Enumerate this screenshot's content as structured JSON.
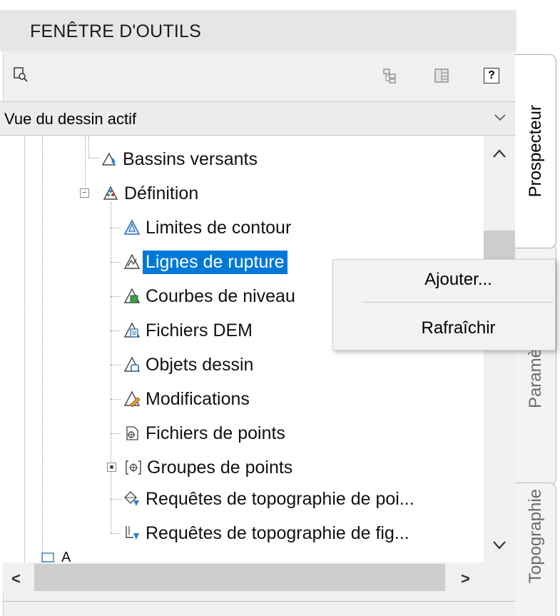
{
  "window": {
    "title": "FENÊTRE D'OUTILS"
  },
  "toolbar": {
    "icons": [
      "search-drawing-icon",
      "tree-view-icon",
      "item-view-icon",
      "help-icon"
    ],
    "help_label": "?"
  },
  "view_select": {
    "value": "Vue du dessin actif"
  },
  "tree": {
    "items": [
      {
        "label": "Bassins versants",
        "icon": "catchment-icon"
      },
      {
        "label": "Définition",
        "icon": "surface-definition-icon",
        "expander": "−"
      },
      {
        "label": "Limites de contour",
        "icon": "boundary-icon"
      },
      {
        "label": "Lignes de rupture",
        "icon": "breakline-icon",
        "selected": true
      },
      {
        "label": "Courbes de niveau",
        "icon": "contour-icon"
      },
      {
        "label": "Fichiers DEM",
        "icon": "dem-file-icon"
      },
      {
        "label": "Objets dessin",
        "icon": "drawing-object-icon"
      },
      {
        "label": "Modifications",
        "icon": "edit-icon"
      },
      {
        "label": "Fichiers de points",
        "icon": "point-file-icon"
      },
      {
        "label": "Groupes de points",
        "icon": "point-group-icon",
        "expander": "+"
      },
      {
        "label": "Requêtes de topographie de poi...",
        "icon": "survey-point-query-icon"
      },
      {
        "label": "Requêtes de topographie de fig...",
        "icon": "survey-figure-query-icon"
      }
    ],
    "partial_item": "A"
  },
  "scroll": {
    "left_arrow": "<",
    "right_arrow": ">"
  },
  "tabs": [
    {
      "label": "Prospecteur",
      "active": true
    },
    {
      "label": "Paramètres",
      "active": false
    },
    {
      "label": "Topographie",
      "active": false
    }
  ],
  "context_menu": {
    "items": [
      "Ajouter...",
      "Rafraîchir"
    ]
  },
  "colors": {
    "selection": "#0078d7",
    "panel": "#f0f0f0",
    "header": "#e6e6e6"
  }
}
